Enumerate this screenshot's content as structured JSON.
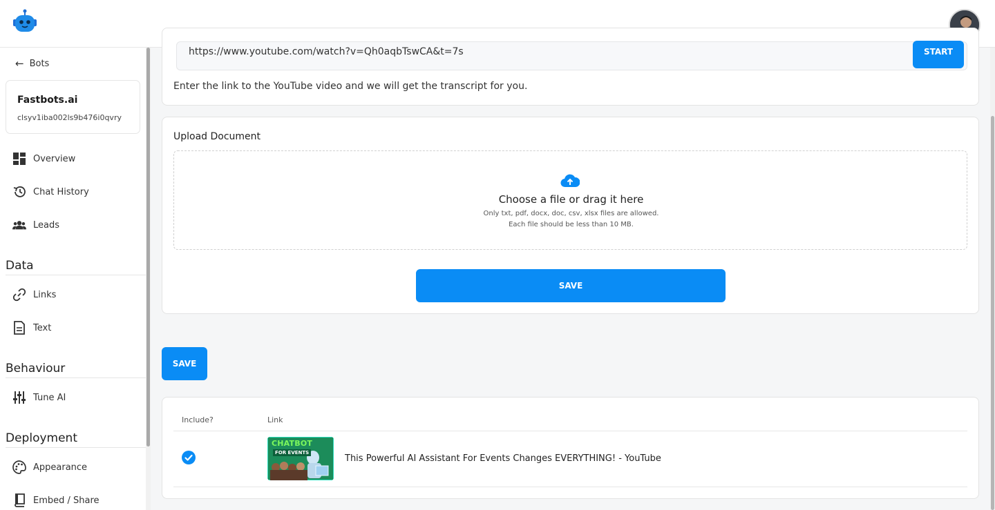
{
  "sidebar": {
    "back_label": "Bots",
    "bot": {
      "name": "Fastbots.ai",
      "id": "clsyv1iba002ls9b476i0qvry"
    },
    "nav": {
      "overview": "Overview",
      "chat_history": "Chat History",
      "leads": "Leads",
      "links": "Links",
      "text": "Text",
      "tune_ai": "Tune AI",
      "appearance": "Appearance",
      "embed_share": "Embed / Share"
    },
    "sections": {
      "data": "Data",
      "behaviour": "Behaviour",
      "deployment": "Deployment"
    }
  },
  "youtube": {
    "url_value": "https://www.youtube.com/watch?v=Qh0aqbTswCA&t=7s",
    "start_label": "START",
    "help": "Enter the link to the YouTube video and we will get the transcript for you."
  },
  "upload": {
    "title": "Upload Document",
    "choose": "Choose a file or drag it here",
    "allowed": "Only txt, pdf, docx, doc, csv, xlsx files are allowed.",
    "size_limit": "Each file should be less than 10 MB.",
    "save_label": "SAVE"
  },
  "save_label": "SAVE",
  "table": {
    "headers": {
      "include": "Include?",
      "link": "Link"
    },
    "rows": [
      {
        "included": true,
        "thumbnail_text": {
          "line1": "CHATBOT",
          "line2": "FOR EVENTS"
        },
        "title": "This Powerful AI Assistant For Events Changes EVERYTHING! - YouTube"
      }
    ]
  },
  "colors": {
    "accent": "#0a8cf5",
    "background": "#f5f6f7"
  }
}
